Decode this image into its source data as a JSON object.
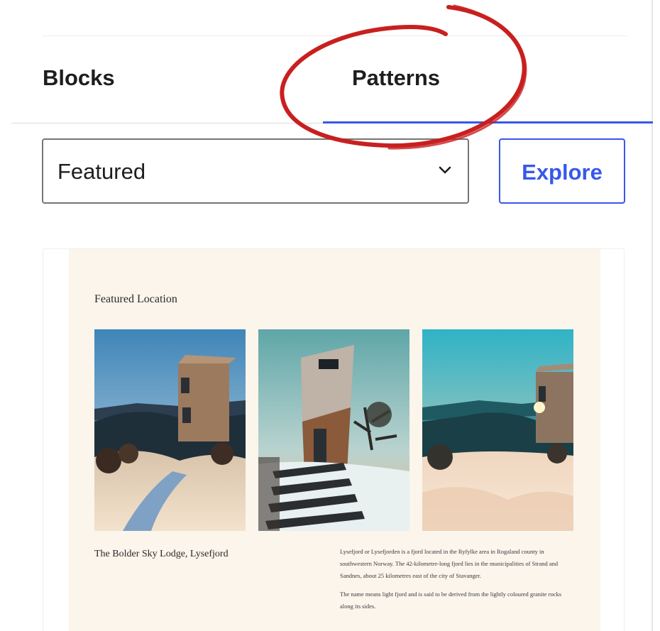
{
  "tabs": [
    {
      "label": "Blocks",
      "active": false
    },
    {
      "label": "Patterns",
      "active": true
    }
  ],
  "category_select": {
    "value": "Featured"
  },
  "explore_button": {
    "label": "Explore"
  },
  "annotation": {
    "color": "#c8201f"
  },
  "accent_color": "#3858e9",
  "preview": {
    "heading": "Featured Location",
    "lodge_name": "The Bolder Sky Lodge, Lysefjord",
    "description": [
      "Lysefjord or Lysefjorden is a fjord located in the Ryfylke area in Rogaland county in southwestern Norway. The 42-kilometre-long fjord lies in the municipalities of Strand and Sandnes, about 25 kilometres east of the city of Stavanger.",
      "The name means light fjord and is said to be derived from the lightly coloured granite rocks along its sides."
    ],
    "background_color": "#fbf5ec"
  }
}
